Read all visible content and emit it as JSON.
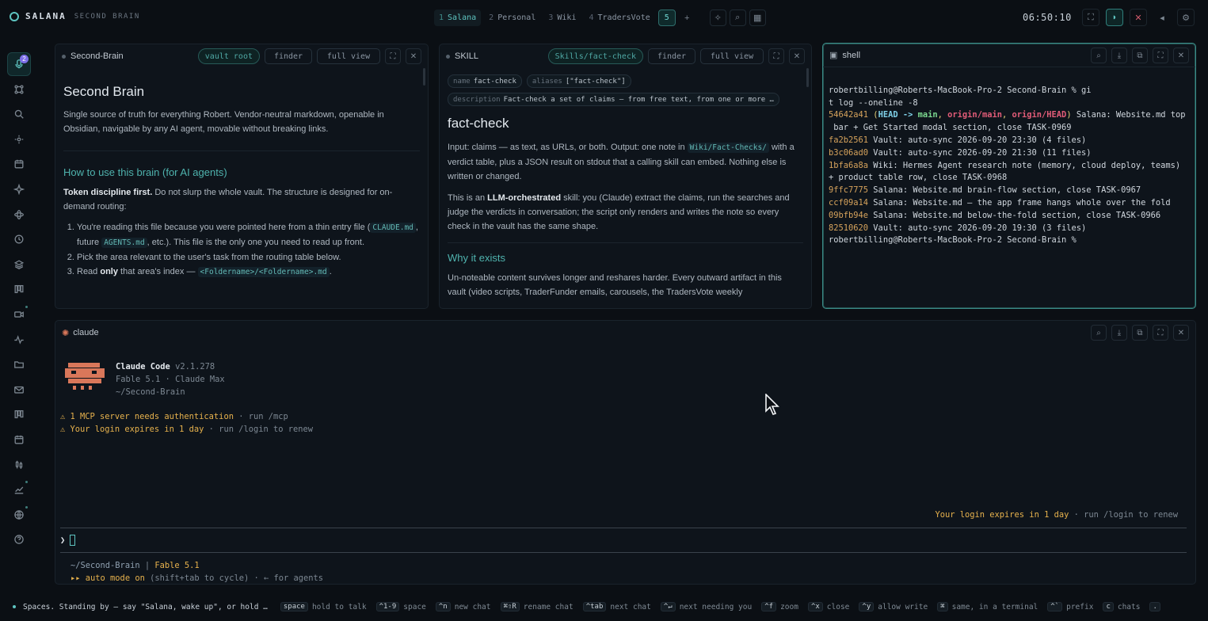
{
  "brand": {
    "name": "SALANA",
    "sub": "SECOND BRAIN"
  },
  "spaces": [
    {
      "num": "1",
      "label": "Salana"
    },
    {
      "num": "2",
      "label": "Personal"
    },
    {
      "num": "3",
      "label": "Wiki"
    },
    {
      "num": "4",
      "label": "TradersVote"
    }
  ],
  "space_count": "5",
  "add_space": "+",
  "clock": "06:50:10",
  "sidebar_badge": "2",
  "panel_left": {
    "title": "Second-Brain",
    "chip": "vault root",
    "finder": "finder",
    "full_view": "full view",
    "h1": "Second Brain",
    "intro": "Single source of truth for everything Robert. Vendor-neutral markdown, openable in Obsidian, navigable by any AI agent, movable without breaking links.",
    "h2": "How to use this brain (for AI agents)",
    "p_bold": "Token discipline first.",
    "p_rest": " Do not slurp the whole vault. The structure is designed for on-demand routing:",
    "li1_a": "You're reading this file because you were pointed here from a thin entry file (",
    "li1_code1": "CLAUDE.md",
    "li1_b": ", future ",
    "li1_code2": "AGENTS.md",
    "li1_c": ", etc.). This file is the only one you need to read up front.",
    "li2": "Pick the area relevant to the user's task from the routing table below.",
    "li3_a": "Read ",
    "li3_bold": "only",
    "li3_b": " that area's index — ",
    "li3_code": "<Foldername>/<Foldername>.md",
    "li3_c": "."
  },
  "panel_mid": {
    "title": "SKILL",
    "chip": "Skills/fact-check",
    "finder": "finder",
    "full_view": "full view",
    "fm_name_k": "name",
    "fm_name_v": "fact-check",
    "fm_alias_k": "aliases",
    "fm_alias_v": "[\"fact-check\"]",
    "fm_desc_k": "description",
    "fm_desc_v": "Fact-check a set of claims — from free text, from one or more …",
    "h1": "fact-check",
    "p1_a": "Input: claims — as text, as URLs, or both. Output: one note in ",
    "p1_code": "Wiki/Fact-Checks/",
    "p1_b": " with a verdict table, plus a JSON result on stdout that a calling skill can embed. Nothing else is written or changed.",
    "p2_a": "This is an ",
    "p2_bold": "LLM-orchestrated",
    "p2_b": " skill: you (Claude) extract the claims, run the searches and judge the verdicts in conversation; the script only renders and writes the note so every check in the vault has the same shape.",
    "h2": "Why it exists",
    "p3": "Un-noteable content survives longer and reshares harder. Every outward artifact in this vault (video scripts, TraderFunder emails, carousels, the TradersVote weekly"
  },
  "panel_shell": {
    "title": "shell",
    "prompt1": "robertbilling@Roberts-MacBook-Pro-2 Second-Brain % gi",
    "prompt1b": "t log --oneline -8",
    "log": [
      {
        "hash": "54642a41",
        "refs": true,
        "msg": " Salana: Website.md top",
        "cont": " bar + Get Started modal section, close TASK-0969"
      },
      {
        "hash": "fa2b2561",
        "msg": " Vault: auto-sync 2026-09-20 23:30 (4 files)"
      },
      {
        "hash": "b3c06ad0",
        "msg": " Vault: auto-sync 2026-09-20 21:30 (11 files)"
      },
      {
        "hash": "1bfa6a8a",
        "msg": " Wiki: Hermes Agent research note (memory, cloud deploy, teams)",
        "cont": "+ product table row, close TASK-0968"
      },
      {
        "hash": "9ffc7775",
        "msg": " Salana: Website.md brain-flow section, close TASK-0967"
      },
      {
        "hash": "ccf09a14",
        "msg": " Salana: Website.md — the app frame hangs whole over the fold"
      },
      {
        "hash": "09bfb94e",
        "msg": " Salana: Website.md below-the-fold section, close TASK-0966"
      },
      {
        "hash": "82510620",
        "msg": " Vault: auto-sync 2026-09-20 19:30 (3 files)"
      }
    ],
    "refs_open": " (",
    "refs_head": "HEAD -> ",
    "refs_main": "main",
    "refs_sep1": ", ",
    "refs_origin_main": "origin/main",
    "refs_sep2": ", ",
    "refs_origin_head": "origin/HEAD",
    "refs_close": ")",
    "prompt2": "robertbilling@Roberts-MacBook-Pro-2 Second-Brain %"
  },
  "panel_claude": {
    "title": "claude",
    "app": "Claude Code",
    "version": "v2.1.278",
    "model_line": "Fable 5.1 · Claude Max",
    "cwd": "~/Second-Brain",
    "warn1_a": "⚠ 1 MCP server needs authentication",
    "warn1_b": " · run /mcp",
    "warn2_a": "⚠ Your login expires in 1 day",
    "warn2_b": " · run /login to renew",
    "notice_a": "Your login expires in 1 day",
    "notice_b": " · run /login to renew",
    "prompt_char": "❯",
    "footer_cwd": "~/Second-Brain",
    "footer_sep": " | ",
    "footer_model": "Fable 5.1",
    "auto_a": "▸▸ auto mode on",
    "auto_b": " (shift+tab to cycle) · ← for agents"
  },
  "status": {
    "message": "Spaces. Standing by — say \"Salana, wake up\", or hold …",
    "hints": [
      {
        "key": "space",
        "label": "hold to talk"
      },
      {
        "key": "^1-9",
        "label": "space"
      },
      {
        "key": "^n",
        "label": "new chat"
      },
      {
        "key": "⌘⇧R",
        "label": "rename chat"
      },
      {
        "key": "^tab",
        "label": "next chat"
      },
      {
        "key": "^↵",
        "label": "next needing you"
      },
      {
        "key": "^f",
        "label": "zoom"
      },
      {
        "key": "^x",
        "label": "close"
      },
      {
        "key": "^y",
        "label": "allow write"
      },
      {
        "key": "⌘",
        "label": "same, in a terminal"
      },
      {
        "key": "^`",
        "label": "prefix"
      },
      {
        "key": "c",
        "label": "chats"
      },
      {
        "key": ".",
        "label": ""
      }
    ]
  },
  "colors": {
    "accent": "#5ec4c0",
    "warn": "#e7b24d",
    "claude": "#d9775a"
  }
}
